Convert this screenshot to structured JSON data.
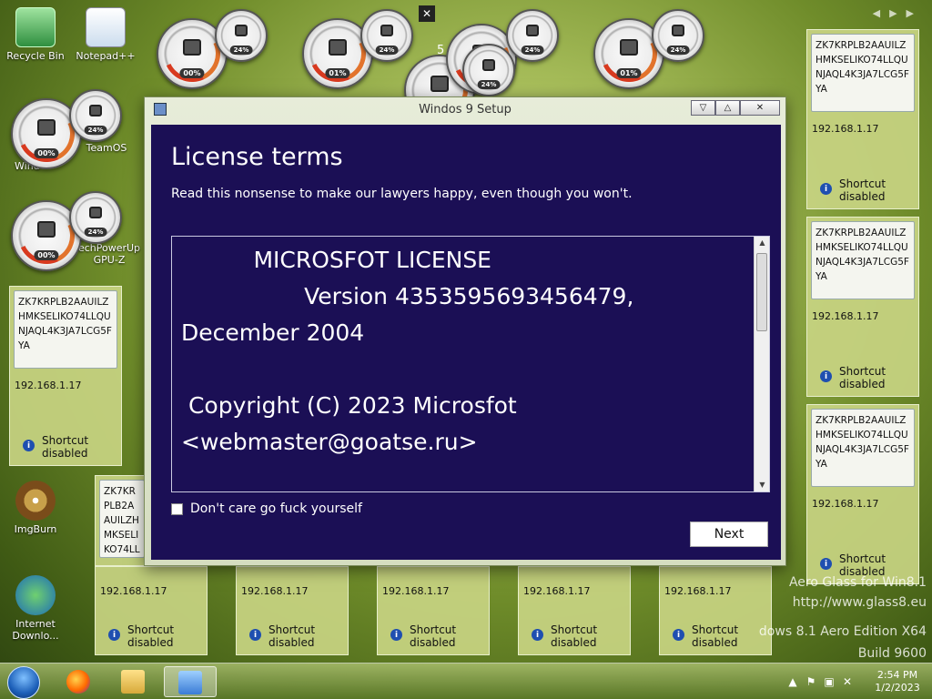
{
  "desktop": {
    "icons": [
      {
        "label": "Recycle Bin"
      },
      {
        "label": "Notepad++"
      },
      {
        "label": "TeamOS"
      },
      {
        "label": "echPowerUp GPU-Z"
      },
      {
        "label": "ImgBurn"
      },
      {
        "label": "Internet Downlo..."
      }
    ],
    "partial_label": "Wind"
  },
  "gauges": [
    {
      "percent": "00%"
    },
    {
      "percent": "24%"
    },
    {
      "percent": "01%"
    },
    {
      "percent": "24%"
    },
    {
      "percent": "24%"
    },
    {
      "percent": "24%"
    },
    {
      "percent": "01%"
    },
    {
      "percent": "24%"
    },
    {
      "percent": "00%"
    },
    {
      "percent": "24%"
    },
    {
      "percent": "00%"
    },
    {
      "percent": "24%"
    }
  ],
  "tiles": {
    "code": "ZK7KRPLB2AAUILZHMKSELIKO74LLQUNJAQL4K3JA7LCG5FYA",
    "ip": "192.168.1.17",
    "shortcut_line1": "Shortcut",
    "shortcut_line2": "disabled"
  },
  "setup": {
    "window_title": "Windos 9 Setup",
    "heading": "License terms",
    "subheading": "Read this nonsense to make our lawyers happy, even though you won't.",
    "license_text": "          MICROSFOT LICENSE\n                 Version 4353595693456479,\nDecember 2004\n\n Copyright (C) 2023 Microsfot\n<webmaster@goatse.ru>",
    "checkbox_label": "Don't care go fuck yourself",
    "next_label": "Next",
    "minimize_glyph": "▽",
    "maximize_glyph": "△",
    "close_glyph": "✕"
  },
  "watermark": {
    "line1": "Aero Glass for Win8.1",
    "line2": "http://www.glass8.eu",
    "line3": "dows 8.1 Aero Edition X64",
    "line4": "Build 9600"
  },
  "overlay": {
    "close_glyph": "✕",
    "number": "5"
  },
  "taskbar": {
    "time": "2:54 PM",
    "date": "1/2/2023"
  },
  "colors": {
    "panel": "#1b0f55",
    "accent_glass": "#a7bd5a"
  }
}
